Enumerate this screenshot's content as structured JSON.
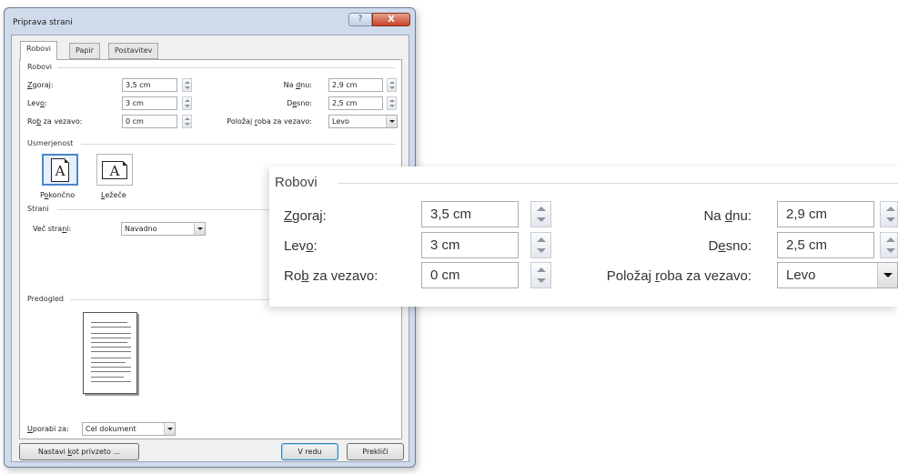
{
  "window": {
    "title": "Priprava strani",
    "help_label": "?",
    "close_label": "X"
  },
  "tabs": [
    {
      "label": "Robovi",
      "active": true
    },
    {
      "label": "Papir",
      "active": false
    },
    {
      "label": "Postavitev",
      "active": false
    }
  ],
  "margins": {
    "group_label": "Robovi",
    "top": {
      "label_pre": "",
      "label_key": "Z",
      "label_post": "goraj:",
      "value": "3,5 cm"
    },
    "left": {
      "label_pre": "Lev",
      "label_key": "o",
      "label_post": ":",
      "value": "3 cm"
    },
    "gutter": {
      "label_pre": "Ro",
      "label_key": "b",
      "label_post": " za vezavo:",
      "value": "0 cm"
    },
    "bottom": {
      "label_pre": "Na ",
      "label_key": "d",
      "label_post": "nu:",
      "value": "2,9 cm"
    },
    "right": {
      "label_pre": "D",
      "label_key": "e",
      "label_post": "sno:",
      "value": "2,5 cm"
    },
    "gutter_position": {
      "label_pre": "Položaj ",
      "label_key": "r",
      "label_post": "oba za vezavo:",
      "value": "Levo"
    }
  },
  "orientation": {
    "group_label": "Usmerjenost",
    "portrait": {
      "label_pre": "P",
      "label_key": "o",
      "label_post": "končno",
      "glyph": "A"
    },
    "landscape": {
      "label_pre": "",
      "label_key": "L",
      "label_post": "ežeče",
      "glyph": "A"
    },
    "selected": "portrait"
  },
  "pages": {
    "group_label": "Strani",
    "multiple_label_pre": "Več stra",
    "multiple_label_key": "n",
    "multiple_label_post": "i:",
    "multiple_value": "Navadno"
  },
  "preview": {
    "group_label": "Predogled",
    "apply_label_pre": "",
    "apply_label_key": "U",
    "apply_label_post": "porabi za:",
    "apply_value": "Cel dokument"
  },
  "buttons": {
    "default_label_pre": "Nastavi ",
    "default_label_key": "k",
    "default_label_post": "ot privzeto ...",
    "ok": "V redu",
    "cancel": "Prekliči"
  },
  "icons": {
    "portrait": "portrait-page-icon",
    "landscape": "landscape-page-icon",
    "spinner": "spinner-arrows-icon",
    "dropdown": "chevron-down-icon"
  },
  "colors": {
    "window_frame": "#cfdaea",
    "close_button": "#c7432a",
    "selection": "#4b86c9"
  }
}
